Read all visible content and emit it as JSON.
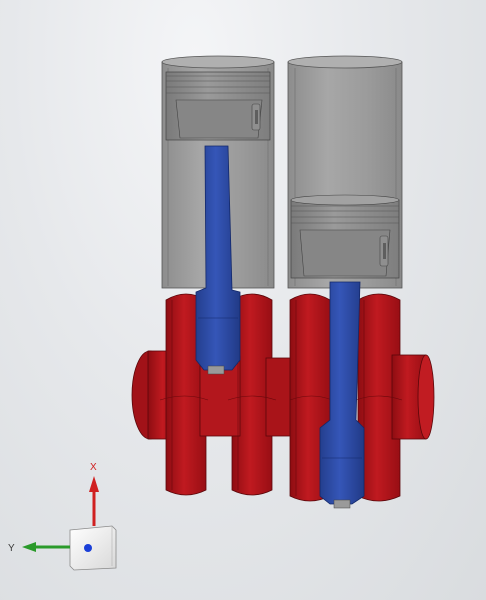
{
  "viewport": {
    "background": "#e4e6e9"
  },
  "model": {
    "parts": [
      {
        "name": "cylinder-1",
        "color": "#9a9a9a"
      },
      {
        "name": "cylinder-2",
        "color": "#9a9a9a"
      },
      {
        "name": "piston-1",
        "color": "#8e8e8e"
      },
      {
        "name": "piston-2",
        "color": "#8e8e8e"
      },
      {
        "name": "connecting-rod-1",
        "color": "#2f4ea8"
      },
      {
        "name": "connecting-rod-2",
        "color": "#2f4ea8"
      },
      {
        "name": "crankshaft",
        "color": "#b8141c"
      }
    ]
  },
  "triad": {
    "x_label": "X",
    "y_label": "Y",
    "x_color": "#d02020",
    "y_color": "#2a9a2a",
    "z_color": "#1a3fd8"
  }
}
